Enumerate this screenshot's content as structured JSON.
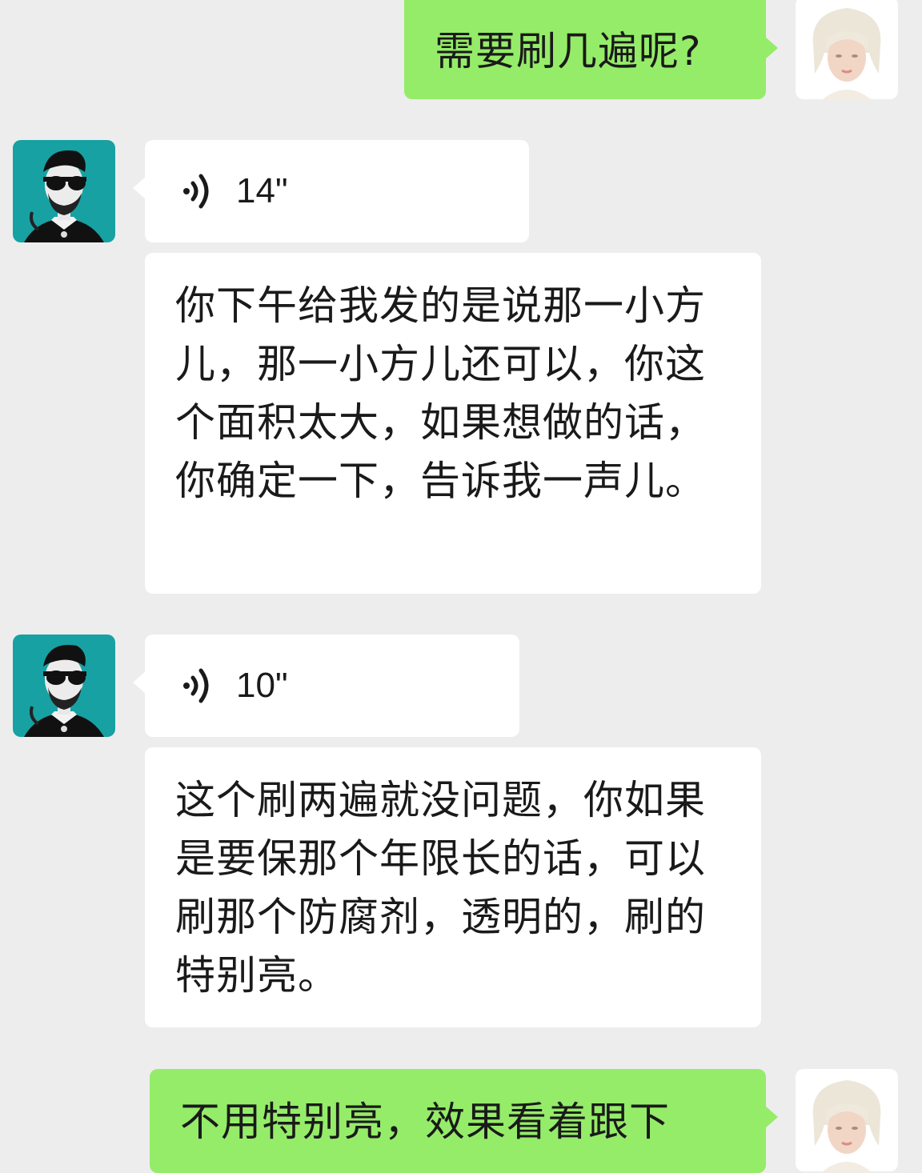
{
  "chat": {
    "messages": [
      {
        "side": "right",
        "type": "text",
        "text": "需要刷几遍呢?"
      },
      {
        "side": "left",
        "type": "voice",
        "duration": "14\"",
        "icon": "voice-wave-icon"
      },
      {
        "side": "left",
        "type": "text",
        "text": "你下午给我发的是说那一小方儿，那一小方儿还可以，你这个面积太大，如果想做的话，你确定一下，告诉我一声儿。"
      },
      {
        "side": "left",
        "type": "voice",
        "duration": "10\"",
        "icon": "voice-wave-icon"
      },
      {
        "side": "left",
        "type": "text",
        "text": "这个刷两遍就没问题，你如果是要保那个年限长的话，可以刷那个防腐剂，透明的，刷的特别亮。"
      },
      {
        "side": "right",
        "type": "text",
        "text": "不用特别亮，效果看着跟下"
      }
    ]
  },
  "colors": {
    "background": "#ededed",
    "incoming_bubble": "#ffffff",
    "outgoing_bubble": "#95ec69",
    "contact_avatar_bg": "#17a1a3"
  }
}
